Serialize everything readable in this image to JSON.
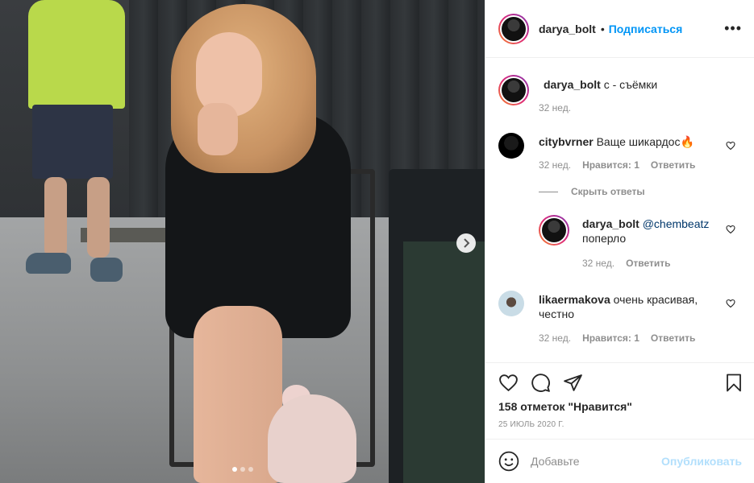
{
  "post": {
    "author": "darya_bolt",
    "follow_label": "Подписаться",
    "separator": "•",
    "more_label": "•••",
    "caption_text": "с - съёмки",
    "caption_time": "32 нед.",
    "carousel_dots": 3,
    "carousel_active": 0
  },
  "comments": [
    {
      "user": "citybvrner",
      "text": "Ваще шикардос🔥",
      "time": "32 нед.",
      "likes_label": "Нравится: 1",
      "reply_label": "Ответить"
    },
    {
      "user": "likaermakova",
      "text": "очень красивая, честно",
      "time": "32 нед.",
      "likes_label": "Нравится: 1",
      "reply_label": "Ответить"
    }
  ],
  "hide_replies_label": "Скрыть ответы",
  "reply": {
    "user": "darya_bolt",
    "mention": "@chembeatz",
    "text": "поперло",
    "time": "32 нед.",
    "reply_label": "Ответить"
  },
  "likes": "158 отметок \"Нравится\"",
  "date": "25 ИЮЛЬ 2020 Г.",
  "add_comment": {
    "placeholder": "Добавьте",
    "post_label": "Опубликовать"
  },
  "colors": {
    "accent": "#0095f6",
    "post_disabled": "#b2dffc",
    "muted": "#8e8e8e",
    "text": "#262626"
  },
  "icons": [
    "chevron-right-icon",
    "more-icon",
    "heart-icon",
    "comment-icon",
    "share-icon",
    "bookmark-icon",
    "emoji-icon"
  ]
}
